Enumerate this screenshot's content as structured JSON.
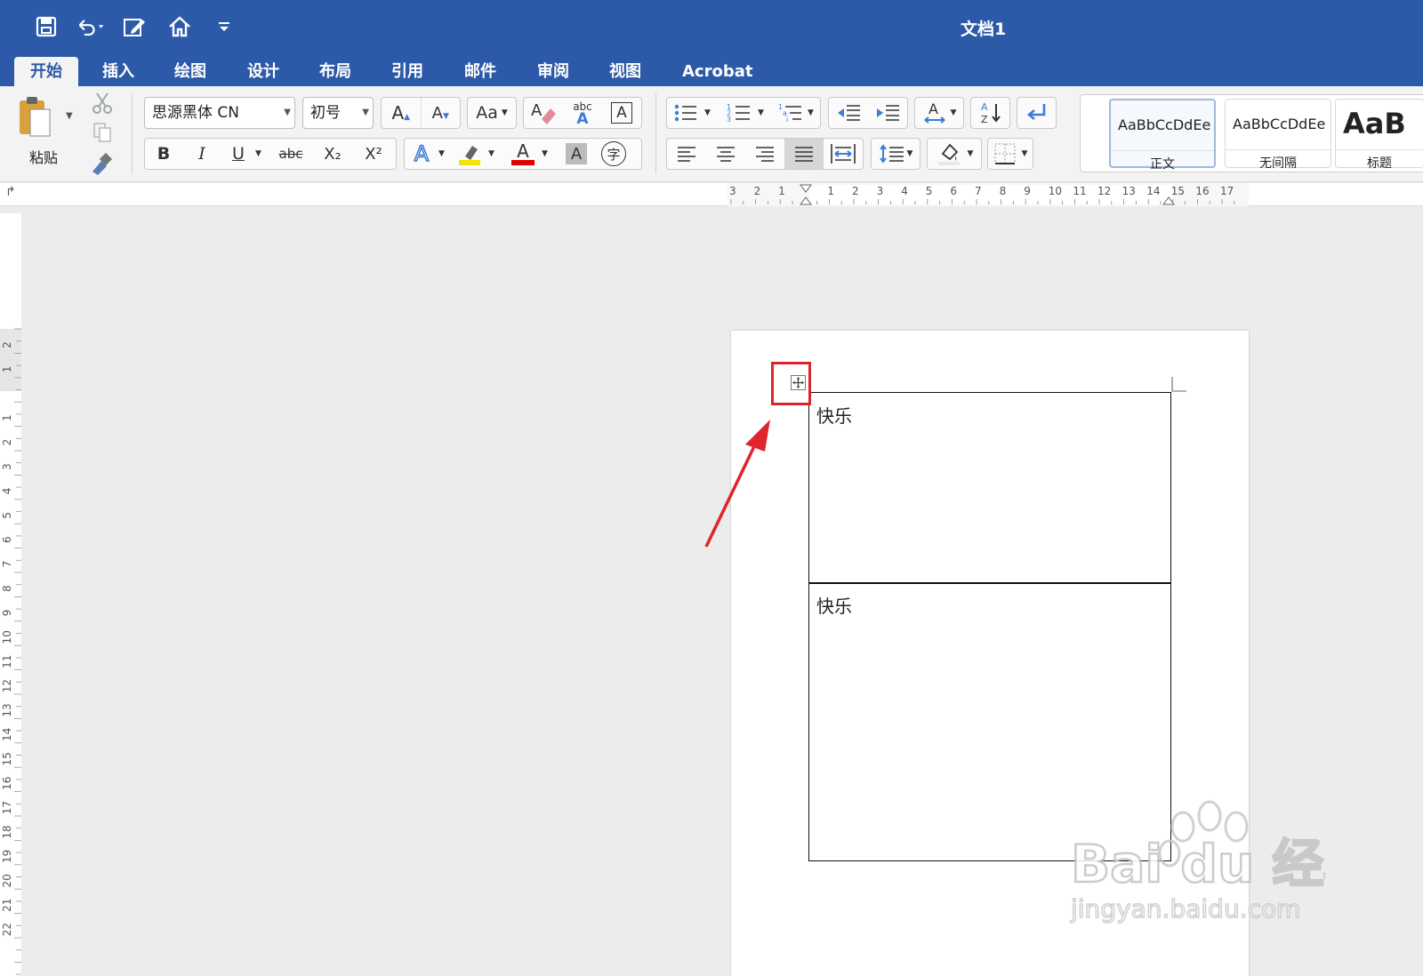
{
  "window": {
    "title": "文档1"
  },
  "tabs": [
    {
      "label": "开始",
      "active": true
    },
    {
      "label": "插入"
    },
    {
      "label": "绘图"
    },
    {
      "label": "设计"
    },
    {
      "label": "布局"
    },
    {
      "label": "引用"
    },
    {
      "label": "邮件"
    },
    {
      "label": "审阅"
    },
    {
      "label": "视图"
    },
    {
      "label": "Acrobat"
    }
  ],
  "clipboard": {
    "paste_label": "粘贴"
  },
  "font": {
    "name": "思源黑体 CN",
    "size": "初号"
  },
  "format_buttons": {
    "bold": "B",
    "italic": "I",
    "underline": "U",
    "strike": "abc",
    "subscript": "X₂",
    "superscript": "X²",
    "grow": "A",
    "shrink": "A",
    "change_case": "Aa",
    "phonetic_abc": "abc",
    "border_char": "A",
    "effects": "A",
    "font_color": "A",
    "shading": "A",
    "enclose": "字"
  },
  "styles": [
    {
      "sample": "AaBbCcDdEe",
      "name": "正文",
      "active": true
    },
    {
      "sample": "AaBbCcDdEe",
      "name": "无间隔"
    },
    {
      "sample": "AaB",
      "name": "标题"
    }
  ],
  "ruler": {
    "h_labels": [
      "3",
      "2",
      "1",
      "1",
      "2",
      "3",
      "4",
      "5",
      "6",
      "7",
      "8",
      "9",
      "10",
      "11",
      "12",
      "13",
      "14",
      "15",
      "16",
      "17"
    ],
    "v_labels": [
      "2",
      "1",
      "1",
      "2",
      "3",
      "4",
      "5",
      "6",
      "7",
      "8",
      "9",
      "10",
      "11",
      "12",
      "13",
      "14",
      "15",
      "16",
      "17",
      "18",
      "19",
      "20",
      "21",
      "22"
    ]
  },
  "document": {
    "table": {
      "rows": [
        {
          "text": "快乐"
        },
        {
          "text": "快乐"
        }
      ]
    }
  },
  "colors": {
    "title_bar": "#2d5aa8",
    "highlight_box": "#d9262b",
    "font_color_bar": "#e00000",
    "highlight_color_bar": "#f5e400"
  },
  "watermark": {
    "brand": "Bai du 经验",
    "url": "jingyan.baidu.com"
  }
}
